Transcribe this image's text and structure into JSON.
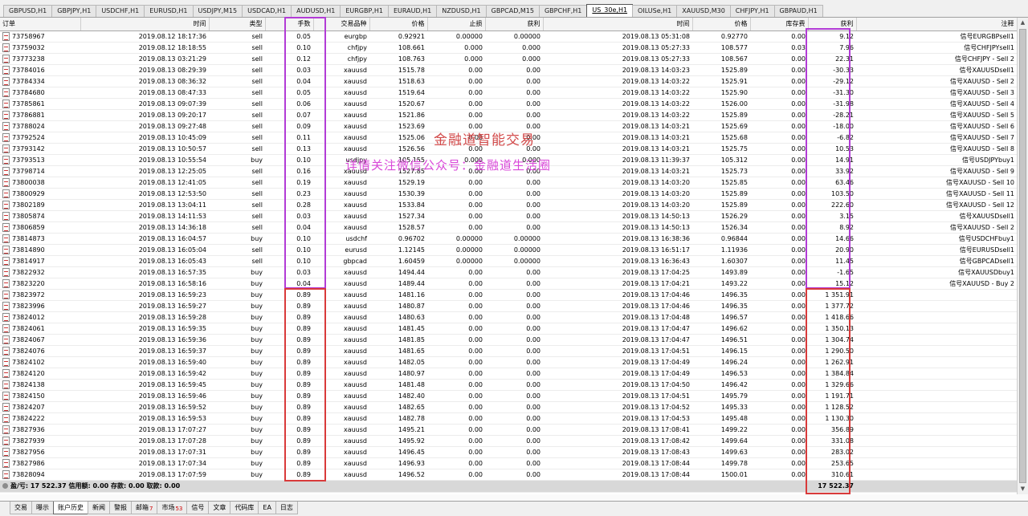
{
  "chart_tabs": [
    "GBPUSD,H1",
    "GBPJPY,H1",
    "USDCHF,H1",
    "EURUSD,H1",
    "USDJPY,M15",
    "USDCAD,H1",
    "AUDUSD,H1",
    "EURGBP,H1",
    "EURAUD,H1",
    "NZDUSD,H1",
    "GBPCAD,M15",
    "GBPCHF,H1",
    "US_30e,H1",
    "OILUSe,H1",
    "XAUUSD,M30",
    "CHFJPY,H1",
    "GBPAUD,H1"
  ],
  "active_chart_tab": 12,
  "columns": [
    "订单",
    "时间",
    "类型",
    "手数",
    "交易品种",
    "价格",
    "止损",
    "获利",
    "时间",
    "价格",
    "库存费",
    "获利",
    "注释"
  ],
  "rows": [
    [
      "73758967",
      "2019.08.12 18:17:36",
      "sell",
      "0.05",
      "eurgbp",
      "0.92921",
      "0.00000",
      "0.00000",
      "2019.08.13 05:31:08",
      "0.92770",
      "0.00",
      "9.12",
      "信号EURGBPsell1"
    ],
    [
      "73759032",
      "2019.08.12 18:18:55",
      "sell",
      "0.10",
      "chfjpy",
      "108.661",
      "0.000",
      "0.000",
      "2019.08.13 05:27:33",
      "108.577",
      "0.03",
      "7.96",
      "信号CHFJPYsell1"
    ],
    [
      "73773238",
      "2019.08.13 03:21:29",
      "sell",
      "0.12",
      "chfjpy",
      "108.763",
      "0.000",
      "0.000",
      "2019.08.13 05:27:33",
      "108.567",
      "0.00",
      "22.31",
      "信号CHFJPY - Sell 2"
    ],
    [
      "73784016",
      "2019.08.13 08:29:39",
      "sell",
      "0.03",
      "xauusd",
      "1515.78",
      "0.00",
      "0.00",
      "2019.08.13 14:03:23",
      "1525.89",
      "0.00",
      "-30.33",
      "信号XAUUSDsell1"
    ],
    [
      "73784334",
      "2019.08.13 08:36:32",
      "sell",
      "0.04",
      "xauusd",
      "1518.63",
      "0.00",
      "0.00",
      "2019.08.13 14:03:22",
      "1525.91",
      "0.00",
      "-29.12",
      "信号XAUUSD - Sell 2"
    ],
    [
      "73784680",
      "2019.08.13 08:47:33",
      "sell",
      "0.05",
      "xauusd",
      "1519.64",
      "0.00",
      "0.00",
      "2019.08.13 14:03:22",
      "1525.90",
      "0.00",
      "-31.30",
      "信号XAUUSD - Sell 3"
    ],
    [
      "73785861",
      "2019.08.13 09:07:39",
      "sell",
      "0.06",
      "xauusd",
      "1520.67",
      "0.00",
      "0.00",
      "2019.08.13 14:03:22",
      "1526.00",
      "0.00",
      "-31.98",
      "信号XAUUSD - Sell 4"
    ],
    [
      "73786881",
      "2019.08.13 09:20:17",
      "sell",
      "0.07",
      "xauusd",
      "1521.86",
      "0.00",
      "0.00",
      "2019.08.13 14:03:22",
      "1525.89",
      "0.00",
      "-28.21",
      "信号XAUUSD - Sell 5"
    ],
    [
      "73788024",
      "2019.08.13 09:27:48",
      "sell",
      "0.09",
      "xauusd",
      "1523.69",
      "0.00",
      "0.00",
      "2019.08.13 14:03:21",
      "1525.69",
      "0.00",
      "-18.00",
      "信号XAUUSD - Sell 6"
    ],
    [
      "73792524",
      "2019.08.13 10:45:09",
      "sell",
      "0.11",
      "xauusd",
      "1525.06",
      "0.00",
      "0.00",
      "2019.08.13 14:03:21",
      "1525.68",
      "0.00",
      "-6.82",
      "信号XAUUSD - Sell 7"
    ],
    [
      "73793142",
      "2019.08.13 10:50:57",
      "sell",
      "0.13",
      "xauusd",
      "1526.56",
      "0.00",
      "0.00",
      "2019.08.13 14:03:21",
      "1525.75",
      "0.00",
      "10.53",
      "信号XAUUSD - Sell 8"
    ],
    [
      "73793513",
      "2019.08.13 10:55:54",
      "buy",
      "0.10",
      "usdjpy",
      "105.155",
      "0.000",
      "0.000",
      "2019.08.13 11:39:37",
      "105.312",
      "0.00",
      "14.91",
      "信号USDJPYbuy1"
    ],
    [
      "73798714",
      "2019.08.13 12:25:05",
      "sell",
      "0.16",
      "xauusd",
      "1527.85",
      "0.00",
      "0.00",
      "2019.08.13 14:03:21",
      "1525.73",
      "0.00",
      "33.92",
      "信号XAUUSD - Sell 9"
    ],
    [
      "73800038",
      "2019.08.13 12:41:05",
      "sell",
      "0.19",
      "xauusd",
      "1529.19",
      "0.00",
      "0.00",
      "2019.08.13 14:03:20",
      "1525.85",
      "0.00",
      "63.46",
      "信号XAUUSD - Sell 10"
    ],
    [
      "73800929",
      "2019.08.13 12:53:50",
      "sell",
      "0.23",
      "xauusd",
      "1530.39",
      "0.00",
      "0.00",
      "2019.08.13 14:03:20",
      "1525.89",
      "0.00",
      "103.50",
      "信号XAUUSD - Sell 11"
    ],
    [
      "73802189",
      "2019.08.13 13:04:11",
      "sell",
      "0.28",
      "xauusd",
      "1533.84",
      "0.00",
      "0.00",
      "2019.08.13 14:03:20",
      "1525.89",
      "0.00",
      "222.60",
      "信号XAUUSD - Sell 12"
    ],
    [
      "73805874",
      "2019.08.13 14:11:53",
      "sell",
      "0.03",
      "xauusd",
      "1527.34",
      "0.00",
      "0.00",
      "2019.08.13 14:50:13",
      "1526.29",
      "0.00",
      "3.15",
      "信号XAUUSDsell1"
    ],
    [
      "73806859",
      "2019.08.13 14:36:18",
      "sell",
      "0.04",
      "xauusd",
      "1528.57",
      "0.00",
      "0.00",
      "2019.08.13 14:50:13",
      "1526.34",
      "0.00",
      "8.92",
      "信号XAUUSD - Sell 2"
    ],
    [
      "73814873",
      "2019.08.13 16:04:57",
      "buy",
      "0.10",
      "usdchf",
      "0.96702",
      "0.00000",
      "0.00000",
      "2019.08.13 16:38:36",
      "0.96844",
      "0.00",
      "14.66",
      "信号USDCHFbuy1"
    ],
    [
      "73814890",
      "2019.08.13 16:05:04",
      "sell",
      "0.10",
      "eurusd",
      "1.12145",
      "0.00000",
      "0.00000",
      "2019.08.13 16:51:17",
      "1.11936",
      "0.00",
      "20.90",
      "信号EURUSDsell1"
    ],
    [
      "73814917",
      "2019.08.13 16:05:43",
      "sell",
      "0.10",
      "gbpcad",
      "1.60459",
      "0.00000",
      "0.00000",
      "2019.08.13 16:36:43",
      "1.60307",
      "0.00",
      "11.45",
      "信号GBPCADsell1"
    ],
    [
      "73822932",
      "2019.08.13 16:57:35",
      "buy",
      "0.03",
      "xauusd",
      "1494.44",
      "0.00",
      "0.00",
      "2019.08.13 17:04:25",
      "1493.89",
      "0.00",
      "-1.65",
      "信号XAUUSDbuy1"
    ],
    [
      "73823220",
      "2019.08.13 16:58:16",
      "buy",
      "0.04",
      "xauusd",
      "1489.44",
      "0.00",
      "0.00",
      "2019.08.13 17:04:21",
      "1493.22",
      "0.00",
      "15.12",
      "信号XAUUSD - Buy 2"
    ],
    [
      "73823972",
      "2019.08.13 16:59:23",
      "buy",
      "0.89",
      "xauusd",
      "1481.16",
      "0.00",
      "0.00",
      "2019.08.13 17:04:46",
      "1496.35",
      "0.00",
      "1 351.91",
      ""
    ],
    [
      "73823996",
      "2019.08.13 16:59:27",
      "buy",
      "0.89",
      "xauusd",
      "1480.87",
      "0.00",
      "0.00",
      "2019.08.13 17:04:46",
      "1496.35",
      "0.00",
      "1 377.72",
      ""
    ],
    [
      "73824012",
      "2019.08.13 16:59:28",
      "buy",
      "0.89",
      "xauusd",
      "1480.63",
      "0.00",
      "0.00",
      "2019.08.13 17:04:48",
      "1496.57",
      "0.00",
      "1 418.66",
      ""
    ],
    [
      "73824061",
      "2019.08.13 16:59:35",
      "buy",
      "0.89",
      "xauusd",
      "1481.45",
      "0.00",
      "0.00",
      "2019.08.13 17:04:47",
      "1496.62",
      "0.00",
      "1 350.13",
      ""
    ],
    [
      "73824067",
      "2019.08.13 16:59:36",
      "buy",
      "0.89",
      "xauusd",
      "1481.85",
      "0.00",
      "0.00",
      "2019.08.13 17:04:47",
      "1496.51",
      "0.00",
      "1 304.74",
      ""
    ],
    [
      "73824076",
      "2019.08.13 16:59:37",
      "buy",
      "0.89",
      "xauusd",
      "1481.65",
      "0.00",
      "0.00",
      "2019.08.13 17:04:51",
      "1496.15",
      "0.00",
      "1 290.50",
      ""
    ],
    [
      "73824102",
      "2019.08.13 16:59:40",
      "buy",
      "0.89",
      "xauusd",
      "1482.05",
      "0.00",
      "0.00",
      "2019.08.13 17:04:49",
      "1496.24",
      "0.00",
      "1 262.91",
      ""
    ],
    [
      "73824120",
      "2019.08.13 16:59:42",
      "buy",
      "0.89",
      "xauusd",
      "1480.97",
      "0.00",
      "0.00",
      "2019.08.13 17:04:49",
      "1496.53",
      "0.00",
      "1 384.84",
      ""
    ],
    [
      "73824138",
      "2019.08.13 16:59:45",
      "buy",
      "0.89",
      "xauusd",
      "1481.48",
      "0.00",
      "0.00",
      "2019.08.13 17:04:50",
      "1496.42",
      "0.00",
      "1 329.66",
      ""
    ],
    [
      "73824150",
      "2019.08.13 16:59:46",
      "buy",
      "0.89",
      "xauusd",
      "1482.40",
      "0.00",
      "0.00",
      "2019.08.13 17:04:51",
      "1495.79",
      "0.00",
      "1 191.71",
      ""
    ],
    [
      "73824207",
      "2019.08.13 16:59:52",
      "buy",
      "0.89",
      "xauusd",
      "1482.65",
      "0.00",
      "0.00",
      "2019.08.13 17:04:52",
      "1495.33",
      "0.00",
      "1 128.52",
      ""
    ],
    [
      "73824222",
      "2019.08.13 16:59:53",
      "buy",
      "0.89",
      "xauusd",
      "1482.78",
      "0.00",
      "0.00",
      "2019.08.13 17:04:53",
      "1495.48",
      "0.00",
      "1 130.30",
      ""
    ],
    [
      "73827936",
      "2019.08.13 17:07:27",
      "buy",
      "0.89",
      "xauusd",
      "1495.21",
      "0.00",
      "0.00",
      "2019.08.13 17:08:41",
      "1499.22",
      "0.00",
      "356.89",
      ""
    ],
    [
      "73827939",
      "2019.08.13 17:07:28",
      "buy",
      "0.89",
      "xauusd",
      "1495.92",
      "0.00",
      "0.00",
      "2019.08.13 17:08:42",
      "1499.64",
      "0.00",
      "331.08",
      ""
    ],
    [
      "73827956",
      "2019.08.13 17:07:31",
      "buy",
      "0.89",
      "xauusd",
      "1496.45",
      "0.00",
      "0.00",
      "2019.08.13 17:08:43",
      "1499.63",
      "0.00",
      "283.02",
      ""
    ],
    [
      "73827986",
      "2019.08.13 17:07:34",
      "buy",
      "0.89",
      "xauusd",
      "1496.93",
      "0.00",
      "0.00",
      "2019.08.13 17:08:44",
      "1499.78",
      "0.00",
      "253.65",
      ""
    ],
    [
      "73828094",
      "2019.08.13 17:07:59",
      "buy",
      "0.89",
      "xauusd",
      "1496.52",
      "0.00",
      "0.00",
      "2019.08.13 17:08:44",
      "1500.01",
      "0.00",
      "310.61",
      ""
    ]
  ],
  "summary": {
    "text": "盈/亏: 17 522.37  信用额: 0.00  存款: 0.00  取款: 0.00",
    "total": "17 522.37"
  },
  "watermark": {
    "line1": "金融道智能交易",
    "line2": "详情关注微信公众号：金融道生活圈"
  },
  "bottom_tabs": [
    {
      "label": "交易",
      "badge": ""
    },
    {
      "label": "曝示",
      "badge": ""
    },
    {
      "label": "账户历史",
      "badge": ""
    },
    {
      "label": "新闻",
      "badge": ""
    },
    {
      "label": "警报",
      "badge": ""
    },
    {
      "label": "邮箱",
      "badge": "7"
    },
    {
      "label": "市场",
      "badge": "53"
    },
    {
      "label": "信号",
      "badge": ""
    },
    {
      "label": "文章",
      "badge": ""
    },
    {
      "label": "代码库",
      "badge": ""
    },
    {
      "label": "EA",
      "badge": ""
    },
    {
      "label": "日志",
      "badge": ""
    }
  ],
  "active_bottom_tab": 2,
  "colors": {
    "purple_box": "#b23bd6",
    "red_box": "#d93a3a"
  }
}
